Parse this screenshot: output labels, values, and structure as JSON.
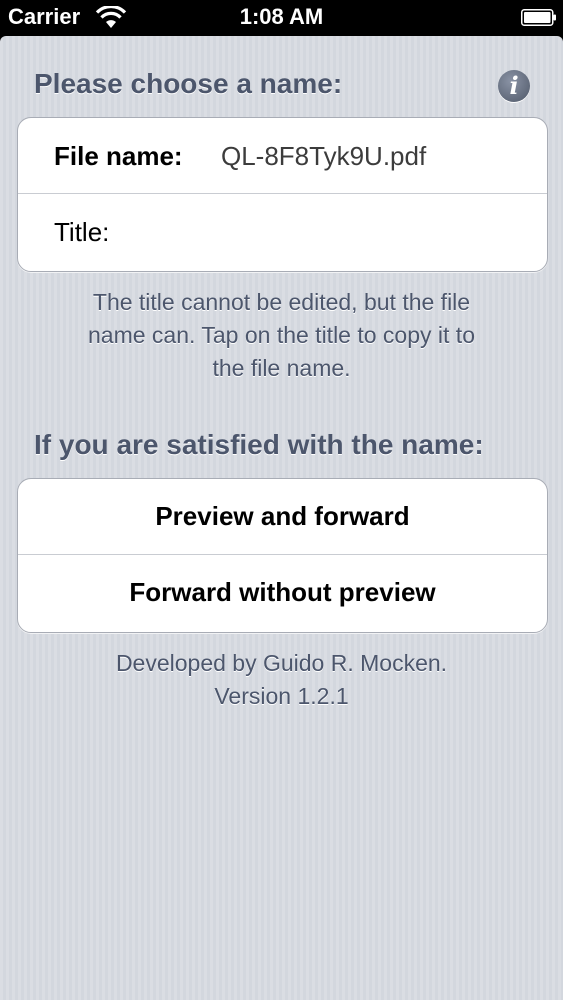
{
  "status_bar": {
    "carrier": "Carrier",
    "time": "1:08 AM",
    "wifi_icon": "wifi-icon",
    "battery_icon": "battery-icon"
  },
  "name_section": {
    "header": "Please choose a name:",
    "info_icon": "info-icon",
    "info_glyph": "i",
    "file_name_label": "File name:",
    "file_name_value": "QL-8F8Tyk9U.pdf",
    "title_label": "Title:",
    "title_value": "",
    "hint_lines": [
      "The title cannot be edited, but the file",
      "name can. Tap on the title to copy it to",
      "the file name."
    ]
  },
  "action_section": {
    "header": "If you are satisfied with the name:",
    "preview_forward_label": "Preview and forward",
    "forward_no_preview_label": "Forward without preview"
  },
  "footer": {
    "developer": "Developed by Guido R. Mocken.",
    "version": "Version 1.2.1"
  },
  "colors": {
    "background": "#d7dae0",
    "header_text": "#4c566c",
    "status_bar": "#000000"
  }
}
